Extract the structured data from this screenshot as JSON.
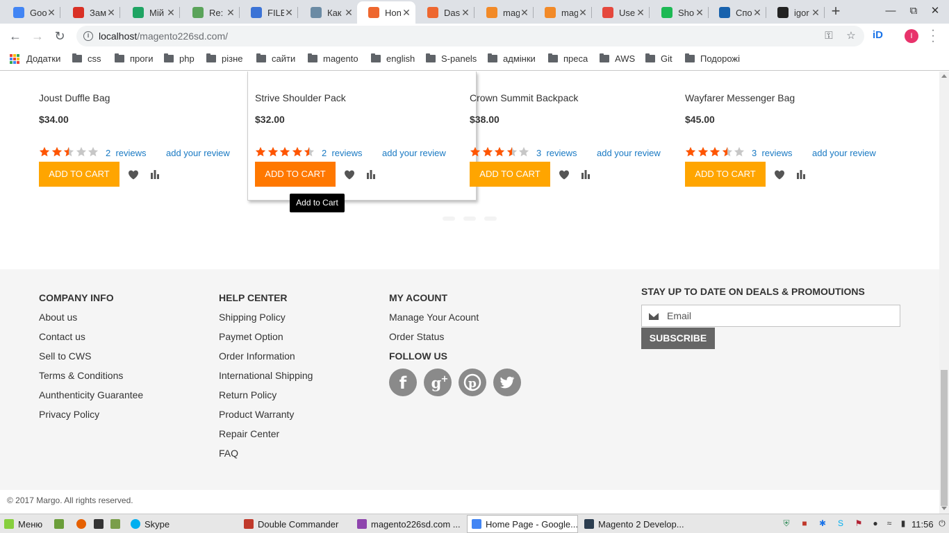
{
  "browser": {
    "tabs": [
      {
        "label": "Goo",
        "icon": "google-icon",
        "color": "#4285f4"
      },
      {
        "label": "Зам",
        "icon": "gmail-icon",
        "color": "#d93025"
      },
      {
        "label": "Мій",
        "icon": "drive-icon",
        "color": "#1fa463"
      },
      {
        "label": "Re:",
        "icon": "mail-icon",
        "color": "#5aa35a"
      },
      {
        "label": "FILE",
        "icon": "file-icon",
        "color": "#3b73d6"
      },
      {
        "label": "Как",
        "icon": "habr-icon",
        "color": "#6b8ba4"
      },
      {
        "label": "Hon",
        "icon": "magento-icon",
        "color": "#ee672f",
        "active": true
      },
      {
        "label": "Das",
        "icon": "magento-icon",
        "color": "#ee672f"
      },
      {
        "label": "mag",
        "icon": "magento-box-icon",
        "color": "#f28a28"
      },
      {
        "label": "mag",
        "icon": "magento-box-icon",
        "color": "#f28a28"
      },
      {
        "label": "Use",
        "icon": "asterisk-icon",
        "color": "#e5483d"
      },
      {
        "label": "Sho",
        "icon": "extension-icon",
        "color": "#1db954"
      },
      {
        "label": "Спо",
        "icon": "de-icon",
        "color": "#1862ad"
      },
      {
        "label": "igor",
        "icon": "github-icon",
        "color": "#222222"
      }
    ],
    "url_host": "localhost",
    "url_path": "/magento226sd.com/",
    "extension_label": "iD",
    "profile_initial": "I",
    "bookmarks": [
      {
        "label": "Додатки",
        "type": "apps"
      },
      {
        "label": "css",
        "type": "folder"
      },
      {
        "label": "проги",
        "type": "folder"
      },
      {
        "label": "php",
        "type": "folder"
      },
      {
        "label": "різне",
        "type": "folder"
      },
      {
        "label": "сайти",
        "type": "folder"
      },
      {
        "label": "magento",
        "type": "folder"
      },
      {
        "label": "english",
        "type": "folder"
      },
      {
        "label": "S-panels",
        "type": "folder"
      },
      {
        "label": "адмінки",
        "type": "folder"
      },
      {
        "label": "преса",
        "type": "folder"
      },
      {
        "label": "AWS",
        "type": "folder"
      },
      {
        "label": "Git",
        "type": "folder"
      },
      {
        "label": "Подорожі",
        "type": "folder"
      }
    ]
  },
  "products": [
    {
      "name": "Joust Duffle Bag",
      "price": "$34.00",
      "rating": 2.5,
      "reviews_count": "2",
      "reviews_label": "reviews",
      "add_review": "add your review",
      "cart_label": "ADD TO CART"
    },
    {
      "name": "Strive Shoulder Pack",
      "price": "$32.00",
      "rating": 4.5,
      "reviews_count": "2",
      "reviews_label": "reviews",
      "add_review": "add your review",
      "cart_label": "ADD TO CART",
      "hovered": true
    },
    {
      "name": "Crown Summit Backpack",
      "price": "$38.00",
      "rating": 3.5,
      "reviews_count": "3",
      "reviews_label": "reviews",
      "add_review": "add your review",
      "cart_label": "ADD TO CART"
    },
    {
      "name": "Wayfarer Messenger Bag",
      "price": "$45.00",
      "rating": 3.5,
      "reviews_count": "3",
      "reviews_label": "reviews",
      "add_review": "add your review",
      "cart_label": "ADD TO CART"
    }
  ],
  "tooltip": "Add to Cart",
  "colors": {
    "star_on": "#ff5501",
    "star_off": "#c7c7c7",
    "cart": "#ffa500",
    "cart_hover": "#ff7800",
    "link": "#1979c3"
  },
  "footer": {
    "company": {
      "heading": "COMPANY INFO",
      "links": [
        "About us",
        "Contact us",
        "Sell to CWS",
        "Terms & Conditions",
        "Aunthenticity Guarantee",
        "Privacy Policy"
      ]
    },
    "help": {
      "heading": "HELP CENTER",
      "links": [
        "Shipping Policy",
        "Paymet Option",
        "Order Information",
        "International Shipping",
        "Return Policy",
        "Product Warranty",
        "Repair Center",
        "FAQ"
      ]
    },
    "account": {
      "heading": "MY ACOUNT",
      "links": [
        "Manage Your Acount",
        "Order Status"
      ]
    },
    "follow": {
      "heading": "FOLLOW US",
      "networks": [
        "facebook-icon",
        "google-plus-icon",
        "pinterest-icon",
        "twitter-icon"
      ]
    },
    "newsletter": {
      "heading": "STAY UP TO DATE ON DEALS & PROMOUTIONS",
      "placeholder": "Email",
      "button": "SUBSCRIBE"
    },
    "copyright": "© 2017 Margo. All rights reserved."
  },
  "taskbar": {
    "menu_label": "Меню",
    "skype_label": "Skype",
    "windows": [
      {
        "label": "Double Commander",
        "icon": "double-commander-icon",
        "color": "#c0392b"
      },
      {
        "label": "magento226sd.com ...",
        "icon": "phpstorm-icon",
        "color": "#8e44ad"
      },
      {
        "label": "Home Page - Google...",
        "icon": "chrome-icon",
        "color": "#4285f4",
        "active": true
      },
      {
        "label": "Magento 2 Develop...",
        "icon": "pdf-icon",
        "color": "#2c3e50"
      }
    ],
    "time": "11:56"
  }
}
